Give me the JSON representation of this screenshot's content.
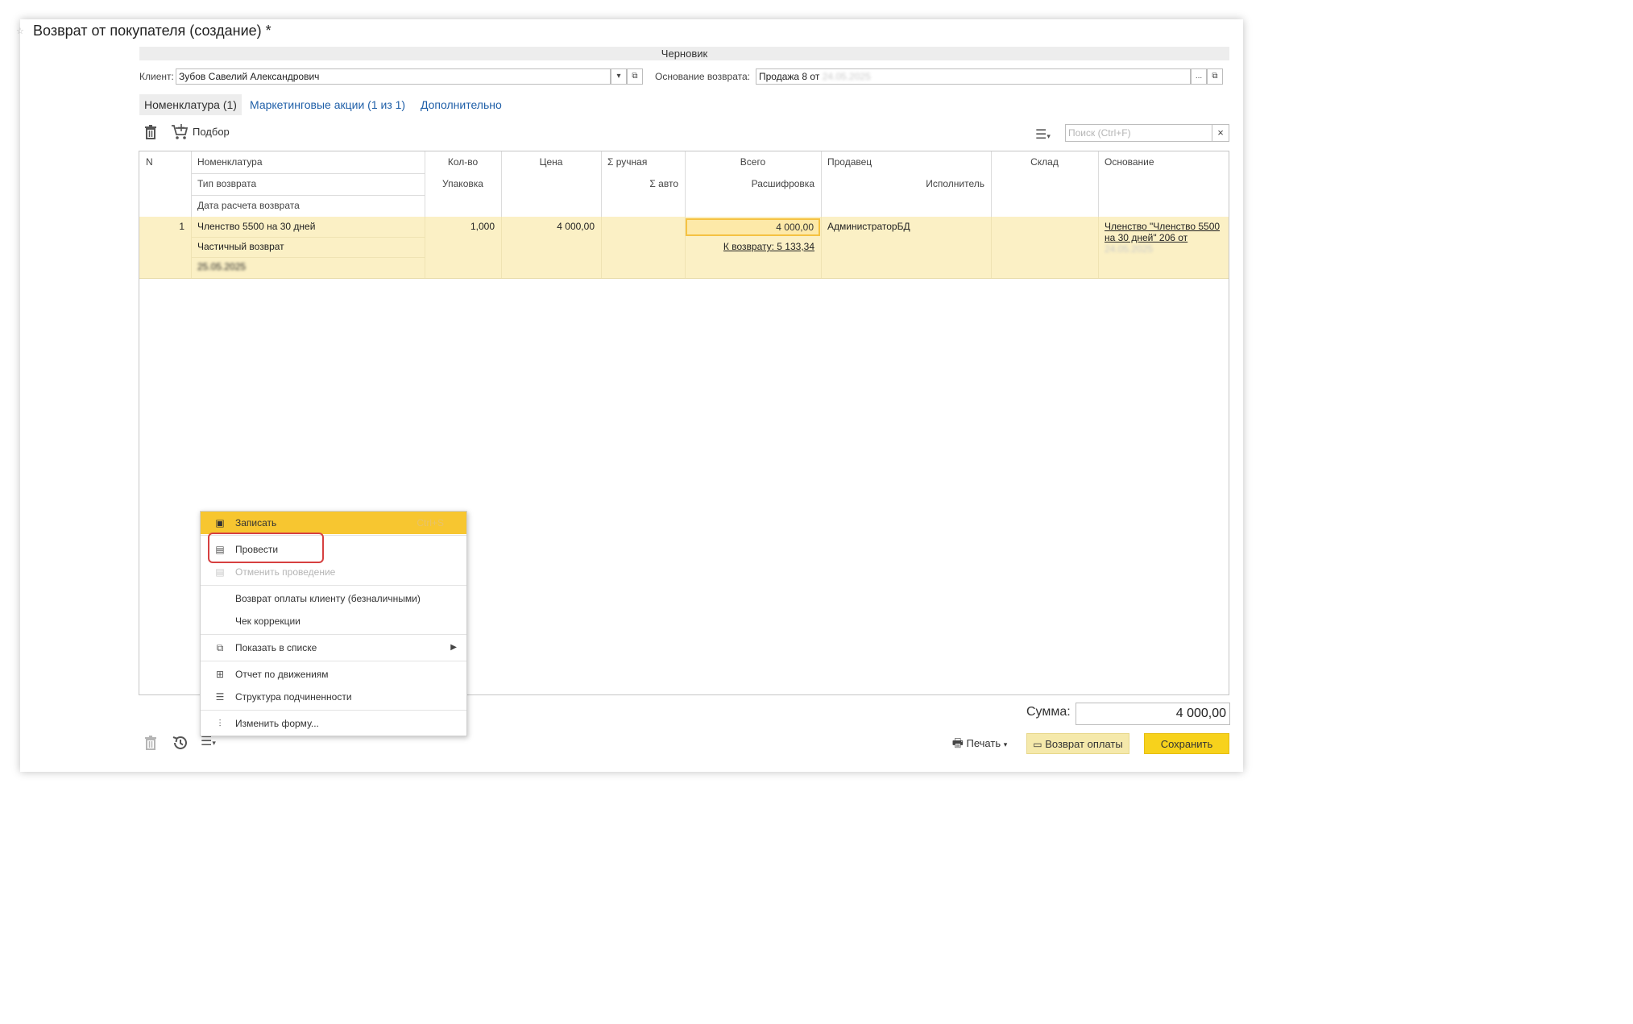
{
  "window": {
    "title": "Возврат от покупателя (создание) *",
    "status": "Черновик"
  },
  "form": {
    "client_label": "Клиент:",
    "client_value": "Зубов Савелий Александрович",
    "basis_label": "Основание возврата:",
    "basis_value": "Продажа 8 от",
    "basis_date": "24.05.2025",
    "btn_dropdown": "▾",
    "btn_open": "⧉",
    "btn_more": "..."
  },
  "tabs": [
    {
      "label": "Номенклатура (1)",
      "active": true
    },
    {
      "label": "Маркетинговые акции (1 из 1)",
      "active": false
    },
    {
      "label": "Дополнительно",
      "active": false
    }
  ],
  "toolbar": {
    "pick_label": "Подбор",
    "search_placeholder": "Поиск (Ctrl+F)",
    "search_clear": "×"
  },
  "table": {
    "headers": {
      "n": "N",
      "nomenclature": "Номенклатура",
      "return_type": "Тип возврата",
      "return_date": "Дата расчета возврата",
      "qty": "Кол-во",
      "pack": "Упаковка",
      "price": "Цена",
      "sum_manual": "Σ ручная",
      "sum_auto": "Σ авто",
      "total": "Всего",
      "breakdown": "Расшифровка",
      "seller": "Продавец",
      "executor": "Исполнитель",
      "warehouse": "Склад",
      "basis": "Основание"
    },
    "rows": [
      {
        "n": "1",
        "nomenclature": "Членство 5500 на 30 дней",
        "return_type": "Частичный возврат",
        "return_date": "25.05.2025",
        "qty": "1,000",
        "price": "4 000,00",
        "total": "4 000,00",
        "breakdown": "К возврату: 5 133,34",
        "seller": "АдминистраторБД",
        "basis_line1": "Членство \"Членство 5500",
        "basis_line2": "на 30 дней\" 206 от",
        "basis_date": "24.05.2025"
      }
    ]
  },
  "context_menu": {
    "items": [
      {
        "label": "Записать",
        "shortcut": "Ctrl+S",
        "icon": "save-icon"
      },
      {
        "label": "Провести",
        "icon": "post-icon"
      },
      {
        "label": "Отменить проведение",
        "icon": "unpost-icon"
      },
      {
        "label": "Возврат оплаты клиенту (безналичными)"
      },
      {
        "label": "Чек коррекции"
      },
      {
        "label": "Показать в списке",
        "icon": "show-in-list-icon"
      },
      {
        "label": "Отчет по движениям",
        "icon": "movements-report-icon"
      },
      {
        "label": "Структура подчиненности",
        "icon": "structure-icon"
      },
      {
        "label": "Изменить форму...",
        "icon": "customize-form-icon"
      }
    ]
  },
  "footer": {
    "sum_label": "Сумма:",
    "sum_value": "4 000,00",
    "print_label": "Печать",
    "return_payment_label": "Возврат оплаты",
    "save_label": "Сохранить"
  },
  "colors": {
    "accent_yellow": "#f7d21c",
    "row_highlight": "#fbf0c5",
    "link_blue": "#1f5fa8",
    "callout_red": "#d64040"
  }
}
